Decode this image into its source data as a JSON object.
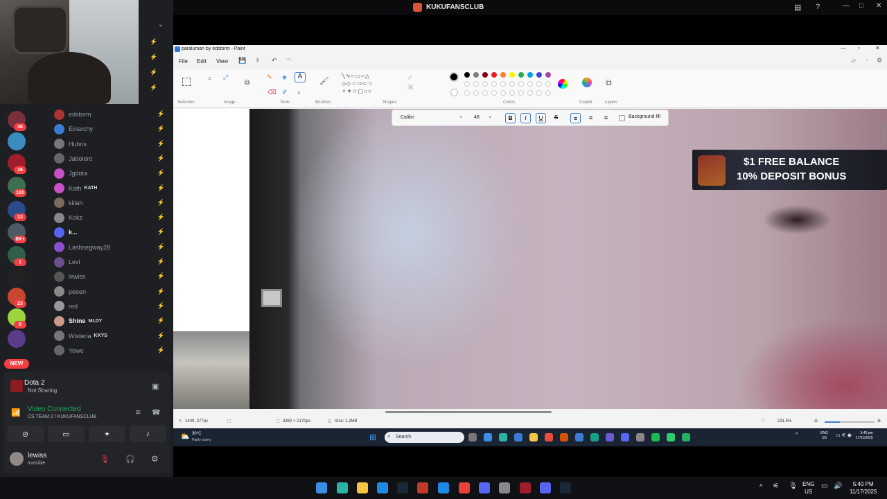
{
  "app_title": "KUKUFANSCLUB",
  "discord": {
    "servers": [
      {
        "badge": "38"
      },
      {
        "badge": ""
      },
      {
        "badge": "16"
      },
      {
        "badge": "100"
      },
      {
        "badge": "13"
      },
      {
        "badge": "8K+"
      },
      {
        "badge": "1"
      },
      {
        "badge": ""
      },
      {
        "badge": "23"
      },
      {
        "badge": "8"
      },
      {
        "badge": ""
      }
    ],
    "new_badge": "NEW",
    "members": [
      {
        "name": "edstorm",
        "tag": ""
      },
      {
        "name": "Einarchy",
        "tag": ""
      },
      {
        "name": "Hubris",
        "tag": ""
      },
      {
        "name": "Jabolero",
        "tag": ""
      },
      {
        "name": "Jgdota",
        "tag": ""
      },
      {
        "name": "Kath",
        "tag": "KATH"
      },
      {
        "name": "killah",
        "tag": ""
      },
      {
        "name": "Kokz",
        "tag": ""
      },
      {
        "name": "k...",
        "tag": ""
      },
      {
        "name": "Lashsegway28",
        "tag": ""
      },
      {
        "name": "Levi",
        "tag": ""
      },
      {
        "name": "lewiss",
        "tag": ""
      },
      {
        "name": "peeen",
        "tag": ""
      },
      {
        "name": "red",
        "tag": ""
      },
      {
        "name": "Shine",
        "tag": "MLDY"
      },
      {
        "name": "Wisteria",
        "tag": "KKYS"
      },
      {
        "name": "Yowe",
        "tag": ""
      }
    ],
    "activity": {
      "game": "Dota 2",
      "status": "Not Sharing"
    },
    "voice": {
      "status": "Video Connected",
      "channel": "CS TEAM 2 / KUKUFANSCLUB"
    },
    "user": {
      "name": "lewiss",
      "status": "Invisible"
    }
  },
  "paint": {
    "window_title": "paraluman by edstorm - Paint",
    "menu": [
      "File",
      "Edit",
      "View"
    ],
    "groups": [
      "Selection",
      "Image",
      "Tools",
      "Brushes",
      "Shapes",
      "Colors",
      "Copilot",
      "Layers"
    ],
    "font": "Calibri",
    "font_size": "48",
    "background_fill": "Background fill",
    "status": {
      "cursor": "1409, 377px",
      "dims": "3382 × 2170px",
      "size": "Size: 1.2MB",
      "zoom": "231.5%"
    },
    "palette": [
      "#000000",
      "#7f7f7f",
      "#880015",
      "#ed1c24",
      "#ff7f27",
      "#fff200",
      "#22b14c",
      "#00a2e8",
      "#3f48cc",
      "#a349a4"
    ]
  },
  "ad": {
    "line1": "$1 FREE BALANCE",
    "line2": "10% DEPOSIT BONUS"
  },
  "inner_taskbar": {
    "weather_temp": "30°C",
    "weather_desc": "Partly sunny",
    "search": "Search",
    "lang1": "ENG",
    "lang2": "US",
    "time": "5:40 pm",
    "date": "17/11/2025"
  },
  "taskbar": {
    "lang1": "ENG",
    "lang2": "US",
    "time": "5:40 PM",
    "date": "11/17/2025"
  }
}
